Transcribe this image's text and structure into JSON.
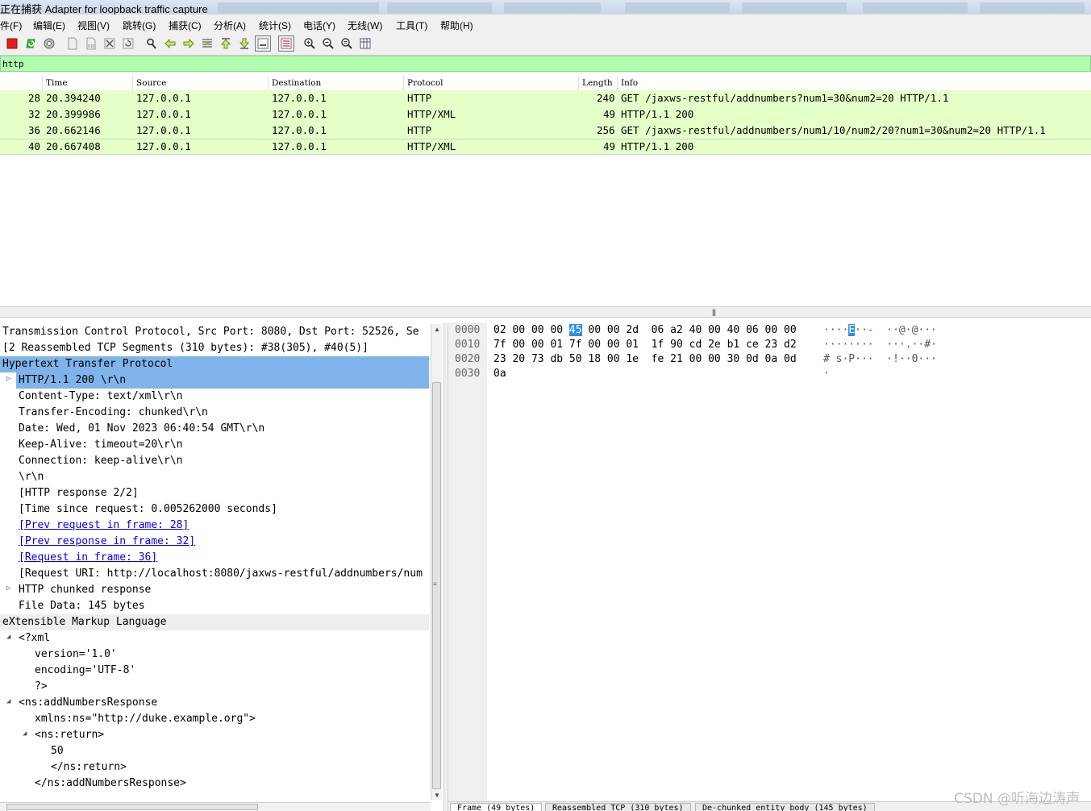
{
  "window": {
    "title": "正在捕获 Adapter for loopback traffic capture"
  },
  "menu": [
    "件(F)",
    "编辑(E)",
    "视图(V)",
    "跳转(G)",
    "捕获(C)",
    "分析(A)",
    "统计(S)",
    "电话(Y)",
    "无线(W)",
    "工具(T)",
    "帮助(H)"
  ],
  "toolbar": {
    "icons": [
      "stop-capture-icon",
      "restart-capture-icon",
      "capture-options-icon",
      "open-file-icon",
      "save-file-icon",
      "close-file-icon",
      "reload-file-icon",
      "find-packet-icon",
      "go-back-icon",
      "go-forward-icon",
      "go-to-packet-icon",
      "first-packet-icon",
      "last-packet-icon",
      "auto-scroll-icon",
      "colorize-icon",
      "zoom-in-icon",
      "zoom-out-icon",
      "normal-size-icon",
      "resize-columns-icon"
    ]
  },
  "filter": {
    "value": "http"
  },
  "packet_list": {
    "columns": [
      "Time",
      "Source",
      "Destination",
      "Protocol",
      "Length",
      "Info"
    ],
    "rows": [
      {
        "no": "28",
        "time": "20.394240",
        "source": "127.0.0.1",
        "destination": "127.0.0.1",
        "protocol": "HTTP",
        "length": "240",
        "info": "GET /jaxws-restful/addnumbers?num1=30&num2=20 HTTP/1.1"
      },
      {
        "no": "32",
        "time": "20.399986",
        "source": "127.0.0.1",
        "destination": "127.0.0.1",
        "protocol": "HTTP/XML",
        "length": "49",
        "info": "HTTP/1.1 200"
      },
      {
        "no": "36",
        "time": "20.662146",
        "source": "127.0.0.1",
        "destination": "127.0.0.1",
        "protocol": "HTTP",
        "length": "256",
        "info": "GET /jaxws-restful/addnumbers/num1/10/num2/20?num1=30&num2=20 HTTP/1.1"
      },
      {
        "no": "40",
        "time": "20.667408",
        "source": "127.0.0.1",
        "destination": "127.0.0.1",
        "protocol": "HTTP/XML",
        "length": "49",
        "info": "HTTP/1.1 200"
      }
    ]
  },
  "details": {
    "rows": [
      "Transmission Control Protocol, Src Port: 8080, Dst Port: 52526, Se",
      "[2 Reassembled TCP Segments (310 bytes): #38(305), #40(5)]",
      "Hypertext Transfer Protocol",
      "HTTP/1.1 200 \\r\\n",
      "Content-Type: text/xml\\r\\n",
      "Transfer-Encoding: chunked\\r\\n",
      "Date: Wed, 01 Nov 2023 06:40:54 GMT\\r\\n",
      "Keep-Alive: timeout=20\\r\\n",
      "Connection: keep-alive\\r\\n",
      "\\r\\n",
      "[HTTP response 2/2]",
      "[Time since request: 0.005262000 seconds]",
      "[Prev request in frame: 28]",
      "[Prev response in frame: 32]",
      "[Request in frame: 36]",
      "[Request URI: http://localhost:8080/jaxws-restful/addnumbers/num",
      "HTTP chunked response",
      "File Data: 145 bytes",
      "eXtensible Markup Language",
      "<?xml",
      "version='1.0'",
      "encoding='UTF-8'",
      "?>",
      "<ns:addNumbersResponse",
      "xmlns:ns=\"http://duke.example.org\">",
      "<ns:return>",
      "50",
      "</ns:return>",
      "</ns:addNumbersResponse>"
    ]
  },
  "bytes": {
    "rows": [
      {
        "offset": "0000",
        "hex_a": "02 00 00 00 ",
        "hex_hl": "45",
        "hex_b": " 00 00 2d  06 a2 40 00 40 06 00 00",
        "asc_a": "····",
        "asc_hl": "E",
        "asc_b": "··-  ··@·@···"
      },
      {
        "offset": "0010",
        "hex_a": "7f 00 00 01 7f 00 00 01  1f 90 cd 2e b1 ce 23 d2",
        "hex_hl": "",
        "hex_b": "",
        "asc_a": "········  ···.··#·",
        "asc_hl": "",
        "asc_b": ""
      },
      {
        "offset": "0020",
        "hex_a": "23 20 73 db 50 18 00 1e  fe 21 00 00 30 0d 0a 0d",
        "hex_hl": "",
        "hex_b": "",
        "asc_a": "# s·P···  ·!··0···",
        "asc_hl": "",
        "asc_b": ""
      },
      {
        "offset": "0030",
        "hex_a": "0a",
        "hex_hl": "",
        "hex_b": "",
        "asc_a": "·",
        "asc_hl": "",
        "asc_b": ""
      }
    ],
    "tabs": [
      "Frame (49 bytes)",
      "Reassembled TCP (310 bytes)",
      "De-chunked entity body (145 bytes)"
    ]
  },
  "watermark": "CSDN @听海边涛声",
  "colors": {
    "http_row": "#e4ffc7",
    "filter_ok": "#afffaf",
    "selection": "#7eb4ea",
    "byte_highlight": "#2d8fea"
  }
}
